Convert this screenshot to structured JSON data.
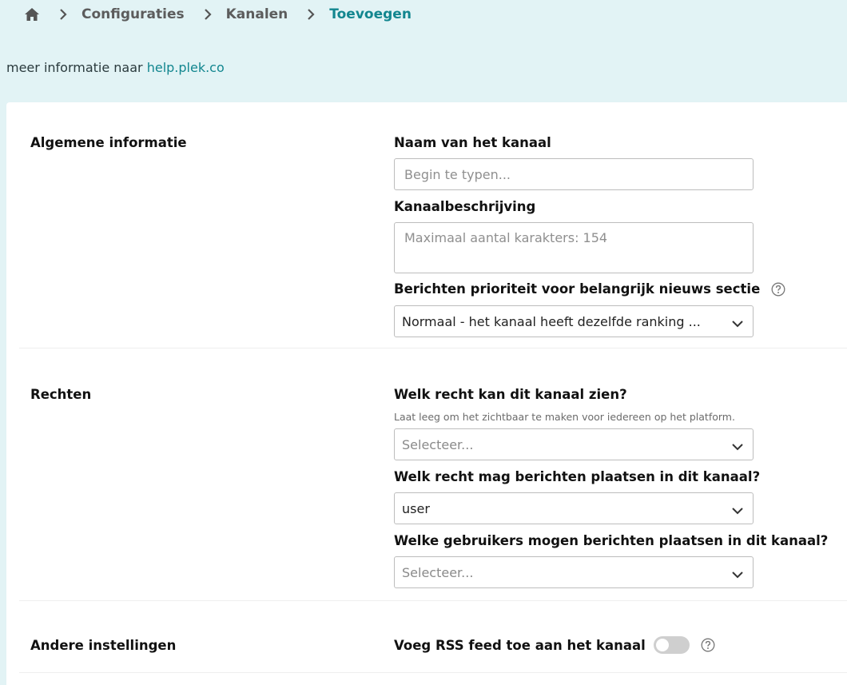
{
  "breadcrumb": {
    "items": [
      "Configuraties",
      "Kanalen",
      "Toevoegen"
    ]
  },
  "info": {
    "prefix": "meer informatie naar ",
    "link": "help.plek.co"
  },
  "sections": {
    "general": {
      "title": "Algemene informatie",
      "name_label": "Naam van het kanaal",
      "name_placeholder": "Begin te typen...",
      "description_label": "Kanaalbeschrijving",
      "description_placeholder": "Maximaal aantal karakters: 154",
      "priority_label": "Berichten prioriteit voor belangrijk nieuws sectie",
      "priority_value": "Normaal - het kanaal heeft dezelfde ranking ..."
    },
    "rights": {
      "title": "Rechten",
      "view_label": "Welk recht kan dit kanaal zien?",
      "view_hint": "Laat leeg om het zichtbaar te maken voor iedereen op het platform.",
      "view_placeholder": "Selecteer...",
      "post_label": "Welk recht mag berichten plaatsen in dit kanaal?",
      "post_value": "user",
      "users_label": "Welke gebruikers mogen berichten plaatsen in dit kanaal?",
      "users_placeholder": "Selecteer..."
    },
    "other": {
      "title": "Andere instellingen",
      "rss_label": "Voeg RSS feed toe aan het kanaal",
      "rss_enabled": false
    }
  },
  "colors": {
    "accent": "#12868f",
    "background": "#e2f3f5"
  },
  "icons": [
    "home-icon",
    "chevron-right-icon",
    "chevron-down-icon",
    "question-circle-icon"
  ]
}
